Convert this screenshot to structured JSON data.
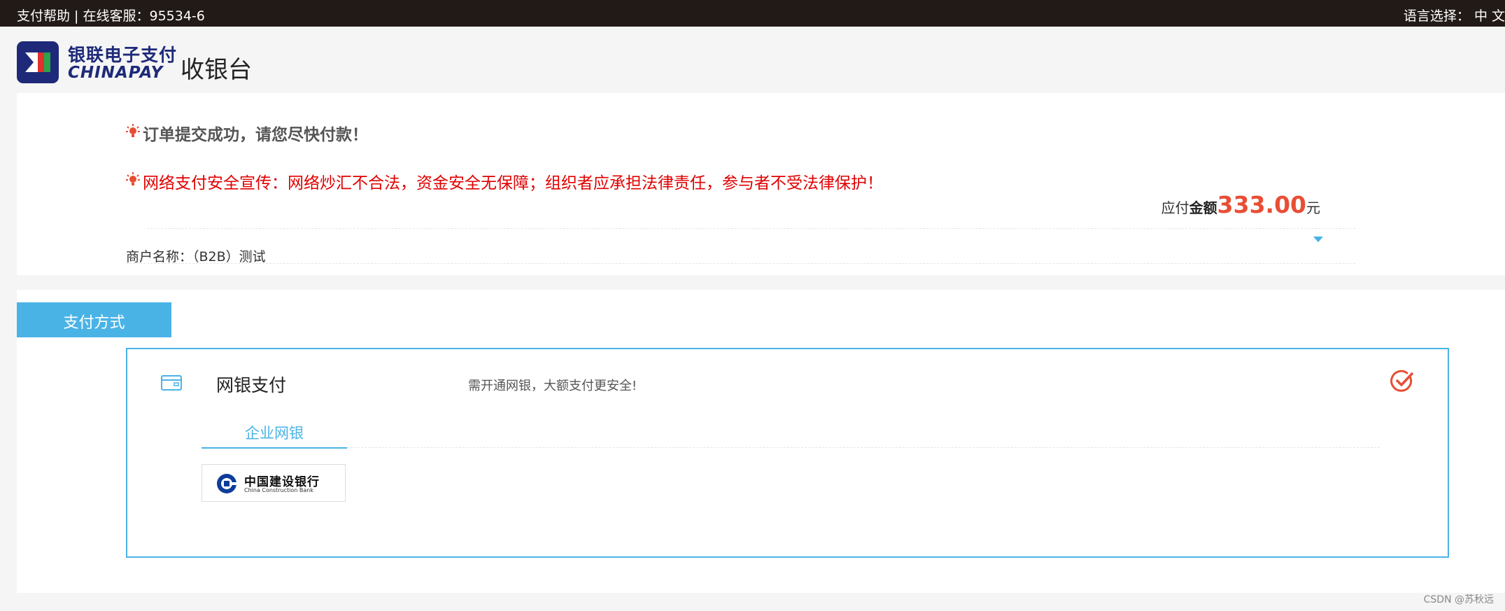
{
  "topbar": {
    "help_text": "支付帮助 | 在线客服：95534-6",
    "language_text": "语言选择： 中 文"
  },
  "header": {
    "logo": {
      "cn_text": "银联电子支付",
      "en_text": "CHINAPAY"
    },
    "title": "收银台"
  },
  "order": {
    "success_notice": "订单提交成功，请您尽快付款！",
    "security_notice": "网络支付安全宣传：网络炒汇不合法，资金安全无保障；组织者应承担法律责任，参与者不受法律保护！",
    "amount_prefix": "应付",
    "amount_label": "金额",
    "amount_value": "333.00",
    "amount_unit": "元",
    "merchant_text": "商户名称：（B2B）测试"
  },
  "payment": {
    "tab_label": "支付方式",
    "method_title": "网银支付",
    "method_desc": "需开通网银，大额支付更安全!",
    "subtab_label": "企业网银",
    "bank": {
      "name": "中国建设银行",
      "en_name": "China Construction Bank"
    }
  },
  "watermark": "CSDN @苏秋远",
  "colors": {
    "accent": "#4ab3e6",
    "amount": "#e84e35",
    "warning": "#e00000",
    "topbar_bg": "#221a17"
  },
  "icons": [
    "lightbulb-icon",
    "bank-card-icon",
    "check-circle-icon",
    "chevron-down-icon",
    "ccb-logo-icon",
    "chinapay-logo-icon"
  ]
}
